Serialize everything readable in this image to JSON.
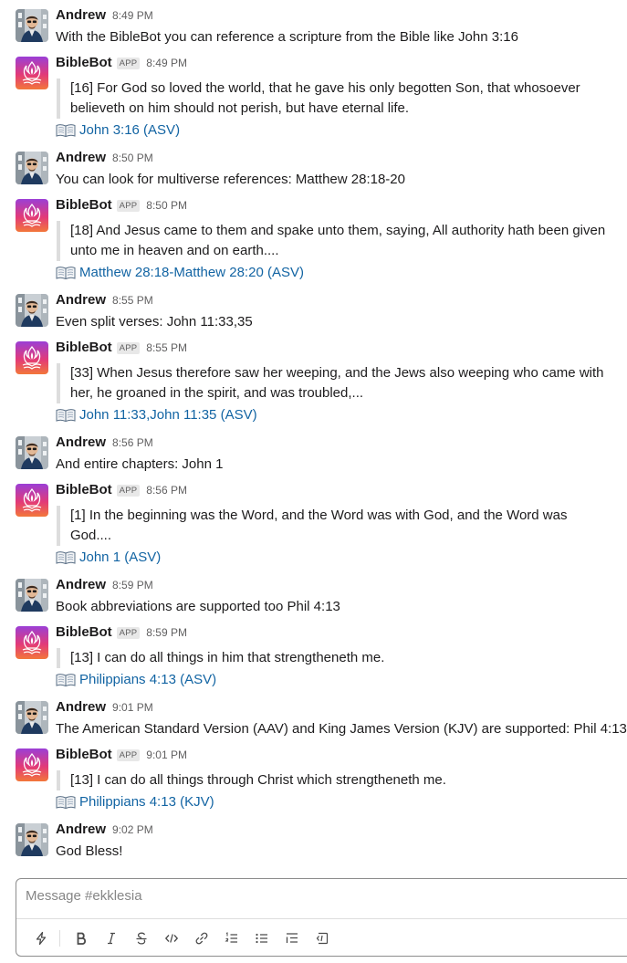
{
  "channel": "ekklesia",
  "composer": {
    "placeholder": "Message #ekklesia",
    "icons": [
      "shortcuts-icon",
      "bold-icon",
      "italic-icon",
      "strikethrough-icon",
      "code-icon",
      "link-icon",
      "ordered-list-icon",
      "bulleted-list-icon",
      "blockquote-icon",
      "code-block-icon"
    ]
  },
  "colors": {
    "link": "#1264a3",
    "quote_bar": "#dddddd",
    "app_badge_bg": "#e8e8e8"
  },
  "messages": [
    {
      "author": "Andrew",
      "time": "8:49 PM",
      "text": "With the BibleBot you can reference a scripture from the Bible like John 3:16"
    },
    {
      "author": "BibleBot",
      "badge": "APP",
      "time": "8:49 PM",
      "quote": [
        "[16] For God so loved the world, that he gave his only begotten Son, that whosoever",
        "believeth on him should not perish, but have eternal life."
      ],
      "ref": "John 3:16 (ASV)"
    },
    {
      "author": "Andrew",
      "time": "8:50 PM",
      "text": "You can look for multiverse references: Matthew 28:18-20"
    },
    {
      "author": "BibleBot",
      "badge": "APP",
      "time": "8:50 PM",
      "quote": [
        "[18] And Jesus came to them and spake unto them, saying, All authority hath been given",
        "unto me in heaven and on earth...."
      ],
      "ref": "Matthew 28:18-Matthew 28:20 (ASV)"
    },
    {
      "author": "Andrew",
      "time": "8:55 PM",
      "text": "Even split verses: John 11:33,35"
    },
    {
      "author": "BibleBot",
      "badge": "APP",
      "time": "8:55 PM",
      "quote": [
        "[33] When Jesus therefore saw her weeping, and the Jews also weeping who came with",
        "her, he groaned in the spirit, and was troubled,..."
      ],
      "ref": "John 11:33,John 11:35 (ASV)"
    },
    {
      "author": "Andrew",
      "time": "8:56 PM",
      "text": "And entire chapters: John 1"
    },
    {
      "author": "BibleBot",
      "badge": "APP",
      "time": "8:56 PM",
      "quote": [
        "[1] In the beginning was the Word, and the Word was with God, and the Word was",
        "God...."
      ],
      "ref": "John 1 (ASV)"
    },
    {
      "author": "Andrew",
      "time": "8:59 PM",
      "text": "Book abbreviations are supported too Phil 4:13"
    },
    {
      "author": "BibleBot",
      "badge": "APP",
      "time": "8:59 PM",
      "quote": [
        "[13] I can do all things in him that strengtheneth me."
      ],
      "ref": "Philippians 4:13 (ASV)"
    },
    {
      "author": "Andrew",
      "time": "9:01 PM",
      "text": "The American Standard Version (AAV) and King James Version (KJV) are supported: Phil 4:13"
    },
    {
      "author": "BibleBot",
      "badge": "APP",
      "time": "9:01 PM",
      "quote": [
        "[13] I can do all things through Christ which strengtheneth me."
      ],
      "ref": "Philippians 4:13 (KJV)"
    },
    {
      "author": "Andrew",
      "time": "9:02 PM",
      "text": "God Bless!"
    }
  ]
}
